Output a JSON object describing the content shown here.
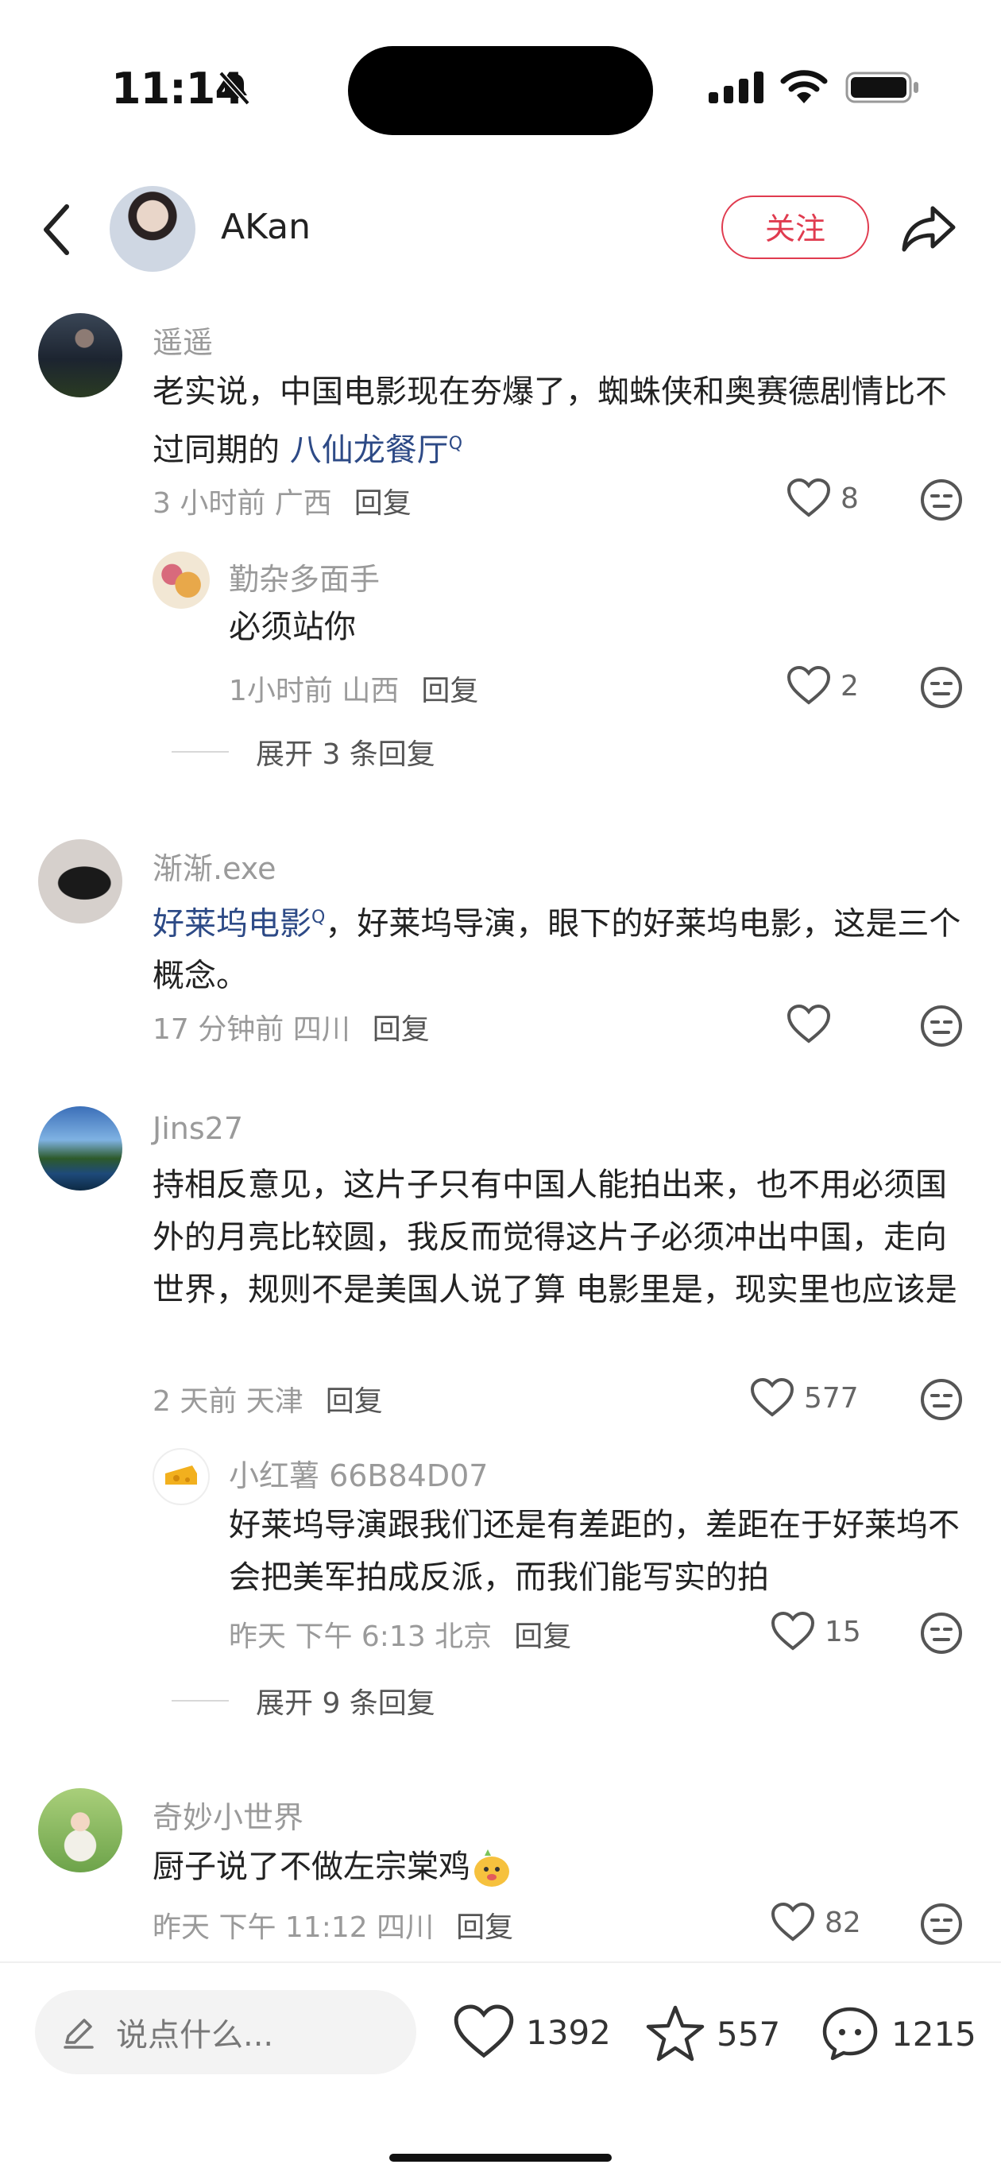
{
  "status_bar": {
    "time": "11:14"
  },
  "header": {
    "author": "AKan",
    "follow_label": "关注"
  },
  "comments": [
    {
      "name": "遥遥",
      "text_before": "老实说，中国电影现在夯爆了，蜘蛛侠和奥赛德剧情比不过同期的 ",
      "link": "八仙龙餐厅",
      "text_after": "",
      "meta": "3 小时前 广西",
      "reply_label": "回复",
      "likes": "8",
      "replies": [
        {
          "name": "勤杂多面手",
          "text": "必须站你",
          "meta": "1小时前 山西",
          "reply_label": "回复",
          "likes": "2"
        }
      ],
      "expand": "展开 3 条回复"
    },
    {
      "name": "渐渐.exe",
      "text_before": "",
      "link": "好莱坞电影",
      "text_after": "，好莱坞导演，眼下的好莱坞电影，这是三个概念。",
      "meta": "17 分钟前 四川",
      "reply_label": "回复",
      "likes": ""
    },
    {
      "name": "Jins27",
      "text": "持相反意见，这片子只有中国人能拍出来，也不用必须国外的月亮比较圆，我反而觉得这片子必须冲出中国，走向世界，规则不是美国人说了算 电影里是，现实里也应该是",
      "meta": "2 天前 天津",
      "reply_label": "回复",
      "likes": "577",
      "replies": [
        {
          "name": "小红薯 66B84D07",
          "text": "好莱坞导演跟我们还是有差距的，差距在于好莱坞不会把美军拍成反派，而我们能写实的拍",
          "meta": "昨天 下午 6:13 北京",
          "reply_label": "回复",
          "likes": "15"
        }
      ],
      "expand": "展开 9 条回复"
    },
    {
      "name": "奇妙小世界",
      "text": "厨子说了不做左宗棠鸡",
      "meta": "昨天 下午 11:12 四川",
      "reply_label": "回复",
      "likes": "82"
    }
  ],
  "bottom_bar": {
    "placeholder": "说点什么...",
    "likes": "1392",
    "favorites": "557",
    "comments": "1215"
  },
  "icons": [
    "back-icon",
    "share-icon",
    "heart-icon",
    "emoji-icon",
    "edit-icon",
    "star-icon",
    "comment-icon"
  ],
  "colors": {
    "accent": "#e03b4f",
    "link": "#2d4a86"
  }
}
